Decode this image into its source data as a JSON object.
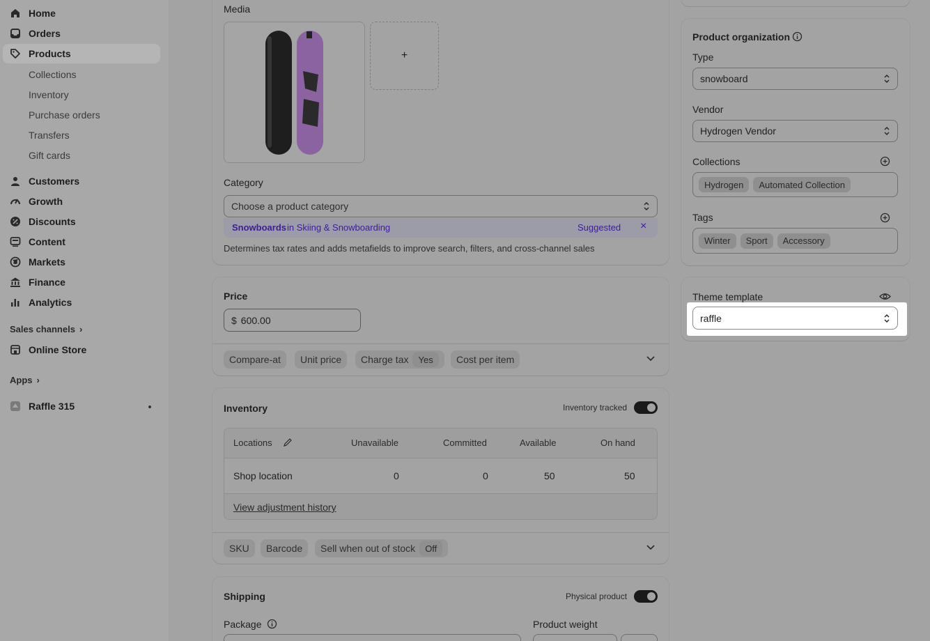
{
  "sidebar": {
    "items": [
      {
        "label": "Home",
        "icon": "home-icon"
      },
      {
        "label": "Orders",
        "icon": "inbox-icon"
      },
      {
        "label": "Products",
        "icon": "tag-icon"
      }
    ],
    "sub_items": [
      "Collections",
      "Inventory",
      "Purchase orders",
      "Transfers",
      "Gift cards"
    ],
    "items2": [
      {
        "label": "Customers",
        "icon": "person-icon"
      },
      {
        "label": "Growth",
        "icon": "gauge-icon"
      },
      {
        "label": "Discounts",
        "icon": "discount-icon"
      },
      {
        "label": "Content",
        "icon": "content-icon"
      },
      {
        "label": "Markets",
        "icon": "globe-icon"
      },
      {
        "label": "Finance",
        "icon": "bank-icon"
      },
      {
        "label": "Analytics",
        "icon": "bar-chart-icon"
      }
    ],
    "sales_channels_label": "Sales channels",
    "online_store_label": "Online Store",
    "apps_label": "Apps",
    "raffle_label": "Raffle 315"
  },
  "media": {
    "title": "Media",
    "add_label": "+"
  },
  "category": {
    "title": "Category",
    "placeholder": "Choose a product category",
    "suggestion_strong": "Snowboards",
    "suggestion_rest": " in Skiing & Snowboarding",
    "suggested_label": "Suggested",
    "help": "Determines tax rates and adds metafields to improve search, filters, and cross-channel sales"
  },
  "price": {
    "title": "Price",
    "currency": "$",
    "value": "600.00",
    "chips": [
      "Compare-at",
      "Unit price",
      "Charge tax",
      "Cost per item"
    ],
    "charge_tax_value": "Yes"
  },
  "inventory": {
    "title": "Inventory",
    "tracked_label": "Inventory tracked",
    "columns": [
      "Locations",
      "Unavailable",
      "Committed",
      "Available",
      "On hand"
    ],
    "rows": [
      {
        "location": "Shop location",
        "unavailable": "0",
        "committed": "0",
        "available": "50",
        "on_hand": "50"
      }
    ],
    "history_link": "View adjustment history",
    "chips": [
      "SKU",
      "Barcode",
      "Sell when out of stock"
    ],
    "sell_oos_value": "Off"
  },
  "shipping": {
    "title": "Shipping",
    "physical_label": "Physical product",
    "package_label": "Package",
    "weight_label": "Product weight"
  },
  "organization": {
    "title": "Product organization",
    "type_label": "Type",
    "type_value": "snowboard",
    "vendor_label": "Vendor",
    "vendor_value": "Hydrogen Vendor",
    "collections_label": "Collections",
    "collections": [
      "Hydrogen",
      "Automated Collection"
    ],
    "tags_label": "Tags",
    "tags": [
      "Winter",
      "Sport",
      "Accessory"
    ]
  },
  "theme": {
    "title": "Theme template",
    "value": "raffle"
  },
  "colors": {
    "suggestion_text": "#4a1fa8",
    "overlay": "#a3a3a3",
    "highlight": "#ffffff"
  }
}
